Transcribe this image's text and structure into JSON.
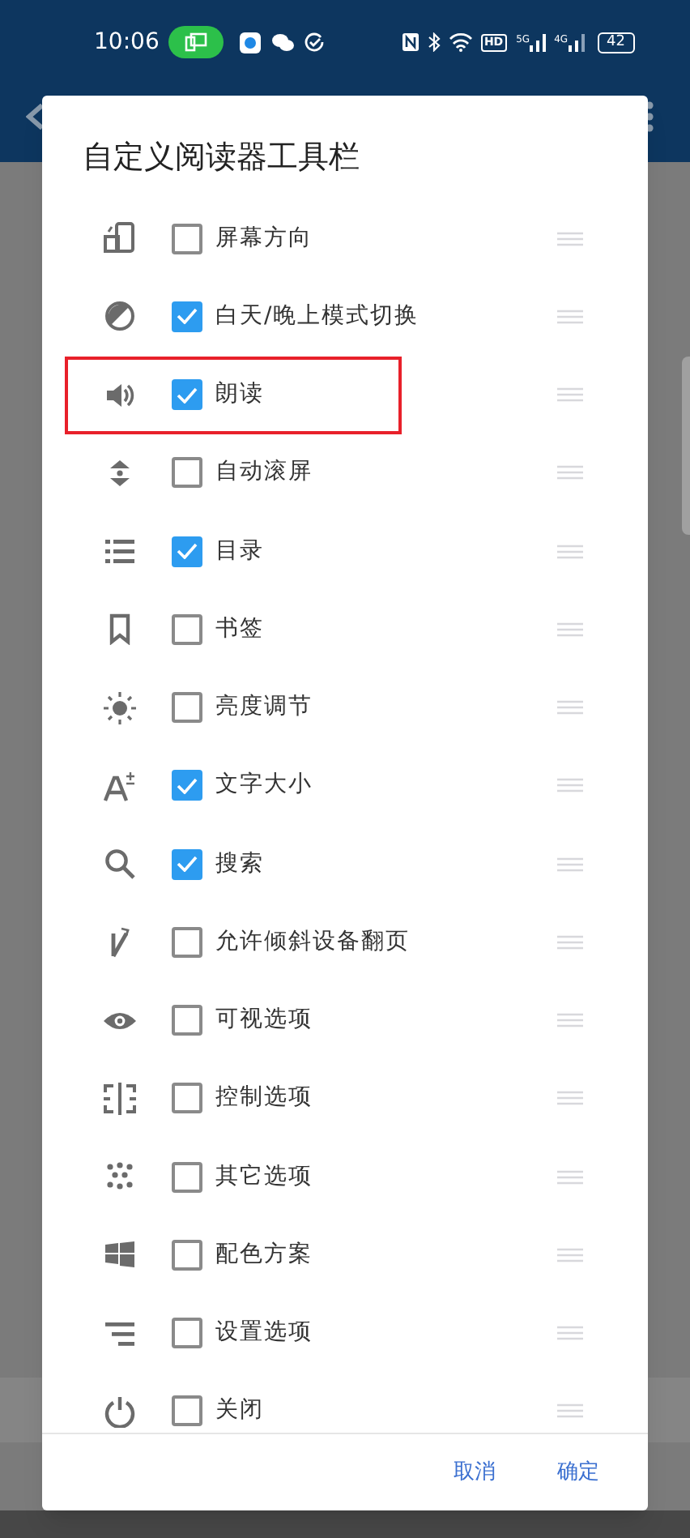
{
  "status_bar": {
    "time": "10:06",
    "indicators": [
      "HD",
      "5G",
      "4G"
    ],
    "battery": "42"
  },
  "dialog": {
    "title": "自定义阅读器工具栏",
    "items": [
      {
        "label": "屏幕方向",
        "checked": false,
        "highlighted": false
      },
      {
        "label": "白天/晚上模式切换",
        "checked": true,
        "highlighted": false
      },
      {
        "label": "朗读",
        "checked": true,
        "highlighted": true
      },
      {
        "label": "自动滚屏",
        "checked": false,
        "highlighted": false
      },
      {
        "label": "目录",
        "checked": true,
        "highlighted": false
      },
      {
        "label": "书签",
        "checked": false,
        "highlighted": false
      },
      {
        "label": "亮度调节",
        "checked": false,
        "highlighted": false
      },
      {
        "label": "文字大小",
        "checked": true,
        "highlighted": false
      },
      {
        "label": "搜索",
        "checked": true,
        "highlighted": false
      },
      {
        "label": "允许倾斜设备翻页",
        "checked": false,
        "highlighted": false
      },
      {
        "label": "可视选项",
        "checked": false,
        "highlighted": false
      },
      {
        "label": "控制选项",
        "checked": false,
        "highlighted": false
      },
      {
        "label": "其它选项",
        "checked": false,
        "highlighted": false
      },
      {
        "label": "配色方案",
        "checked": false,
        "highlighted": false
      },
      {
        "label": "设置选项",
        "checked": false,
        "highlighted": false
      },
      {
        "label": "关闭",
        "checked": false,
        "highlighted": false
      }
    ],
    "buttons": [
      "取消",
      "确定"
    ]
  }
}
